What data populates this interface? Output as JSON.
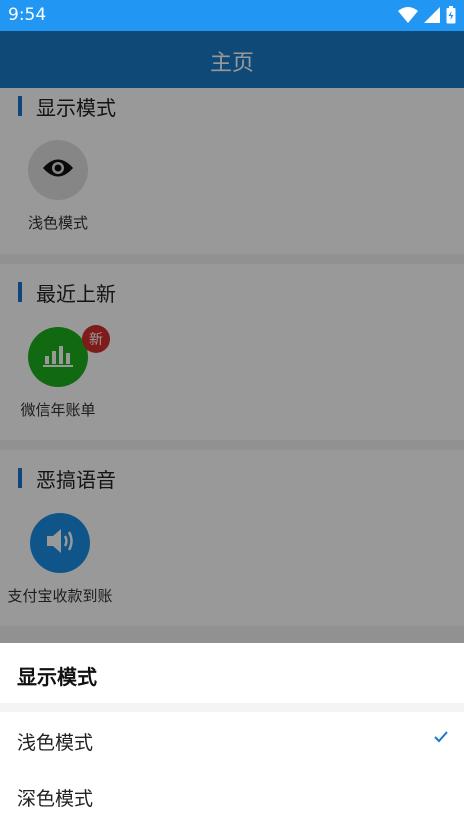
{
  "status_bar": {
    "time": "9:54",
    "wifi_icon": "wifi-icon",
    "signal_icon": "signal-icon",
    "battery_icon": "battery-charging-icon"
  },
  "app_bar": {
    "title": "主页"
  },
  "sections": [
    {
      "title": "显示模式",
      "items": [
        {
          "label": "浅色模式",
          "icon": "eye-icon",
          "icon_bg": "#e0e0e0"
        }
      ]
    },
    {
      "title": "最近上新",
      "items": [
        {
          "label": "微信年账单",
          "icon": "bar-chart-icon",
          "icon_bg": "#1db11d",
          "badge": "新"
        }
      ]
    },
    {
      "title": "恶搞语音",
      "items": [
        {
          "label": "支付宝收款到账",
          "icon": "speaker-icon",
          "icon_bg": "#1a8ee6"
        }
      ]
    }
  ],
  "sheet": {
    "title": "显示模式",
    "options": [
      {
        "label": "浅色模式",
        "selected": true
      },
      {
        "label": "深色模式",
        "selected": false
      }
    ]
  },
  "colors": {
    "status_bar": "#2196f3",
    "app_bar": "#1a7bc8",
    "accent": "#1976d2",
    "badge": "#d32f2f"
  }
}
